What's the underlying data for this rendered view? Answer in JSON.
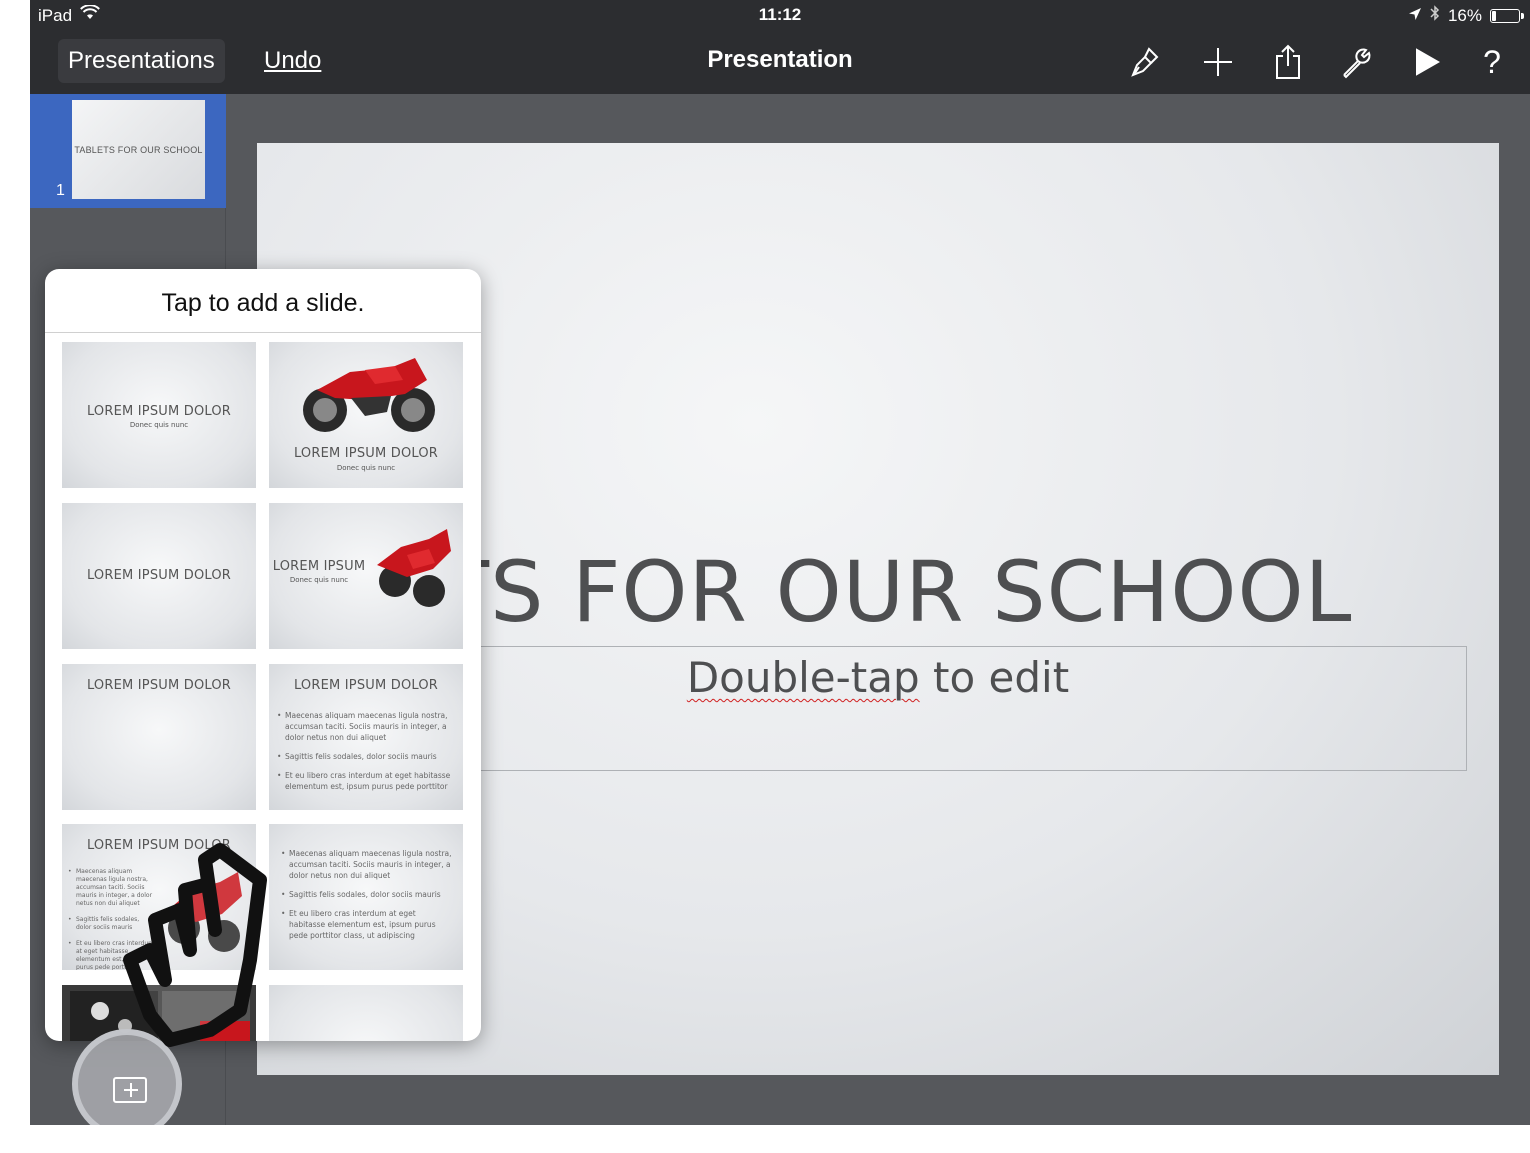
{
  "status_bar": {
    "device": "iPad",
    "time": "11:12",
    "battery_percent": "16%",
    "battery_level": 0.16
  },
  "toolbar": {
    "presentations_label": "Presentations",
    "undo_label": "Undo",
    "title": "Presentation",
    "icons": [
      "paintbrush-icon",
      "plus-icon",
      "share-icon",
      "wrench-icon",
      "play-icon",
      "help-icon"
    ],
    "help_glyph": "?"
  },
  "navigator": {
    "slides": [
      {
        "number": "1",
        "thumb_text": "TABLETS FOR OUR SCHOOL"
      }
    ]
  },
  "slide": {
    "title": "TABLETS FOR OUR SCHOOL",
    "subtitle_word1": "Double-tap",
    "subtitle_rest": " to edit"
  },
  "popover": {
    "header": "Tap to add a slide.",
    "layouts": [
      {
        "title": "LOREM IPSUM DOLOR",
        "subtitle": "Donec quis nunc"
      },
      {
        "title": "LOREM IPSUM DOLOR",
        "subtitle": "Donec quis nunc"
      },
      {
        "title": "LOREM IPSUM DOLOR"
      },
      {
        "title": "LOREM IPSUM",
        "subtitle": "Donec quis nunc"
      },
      {
        "title": "LOREM IPSUM DOLOR"
      },
      {
        "title": "LOREM IPSUM DOLOR",
        "bullets": [
          "Maecenas aliquam maecenas ligula nostra, accumsan taciti. Sociis mauris in integer, a dolor netus non dui aliquet",
          "Sagittis felis sodales, dolor sociis mauris",
          "Et eu libero cras interdum at eget habitasse elementum est, ipsum purus pede porttitor"
        ]
      },
      {
        "title": "LOREM IPSUM DOLOR",
        "bullets": [
          "Maecenas aliquam maecenas ligula nostra, accumsan taciti. Sociis mauris in integer, a dolor netus non dui aliquet",
          "Sagittis felis sodales, dolor sociis mauris",
          "Et eu libero cras interdum at eget habitasse elementum est, ipsum purus pede porttitor class, ut adipiscing"
        ]
      },
      {
        "bullets": [
          "Maecenas aliquam maecenas ligula nostra, accumsan taciti. Sociis mauris in integer, a dolor netus non dui aliquet",
          "Sagittis felis sodales, dolor sociis mauris",
          "Et eu libero cras interdum at eget habitasse elementum est, ipsum purus pede porttitor class, ut adipiscing"
        ]
      }
    ]
  },
  "colors": {
    "toolbar_bg": "#2c2d30",
    "canvas_bg": "#56585c",
    "selection_blue": "#3c67c0",
    "bike_red": "#c8161d"
  }
}
